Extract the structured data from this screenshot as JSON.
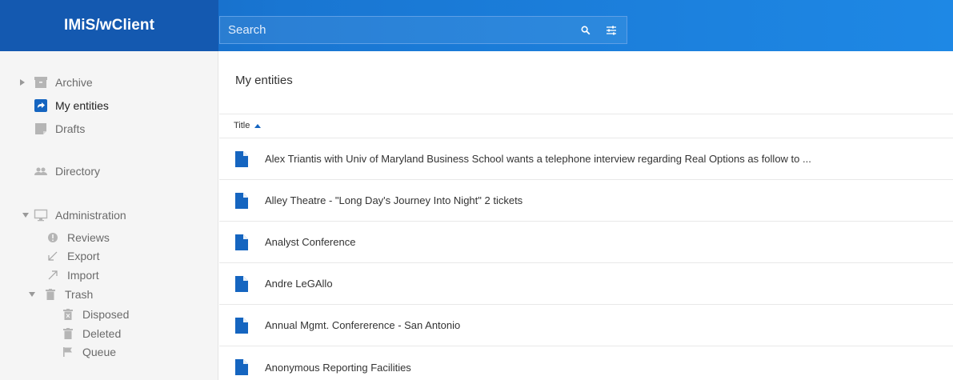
{
  "app": {
    "title": "IMiS/wClient"
  },
  "search": {
    "placeholder": "Search"
  },
  "sidebar": {
    "archive": "Archive",
    "my_entities": "My entities",
    "drafts": "Drafts",
    "directory": "Directory",
    "administration": "Administration",
    "reviews": "Reviews",
    "export": "Export",
    "import": "Import",
    "trash": "Trash",
    "disposed": "Disposed",
    "deleted": "Deleted",
    "queue": "Queue"
  },
  "main": {
    "title": "My entities",
    "column_title": "Title",
    "sort": "ascending",
    "rows": [
      "Alex Triantis with Univ of Maryland Business School wants a telephone interview regarding Real Options as follow to ...",
      "Alley Theatre - \"Long Day's Journey Into Night\" 2 tickets",
      "Analyst Conference",
      "Andre LeGAllo",
      "Annual Mgmt. Confererence - San Antonio",
      "Anonymous Reporting Facilities"
    ]
  },
  "colors": {
    "header": "#1976d2",
    "accent": "#1565c0",
    "icon": "#9e9e9e"
  }
}
